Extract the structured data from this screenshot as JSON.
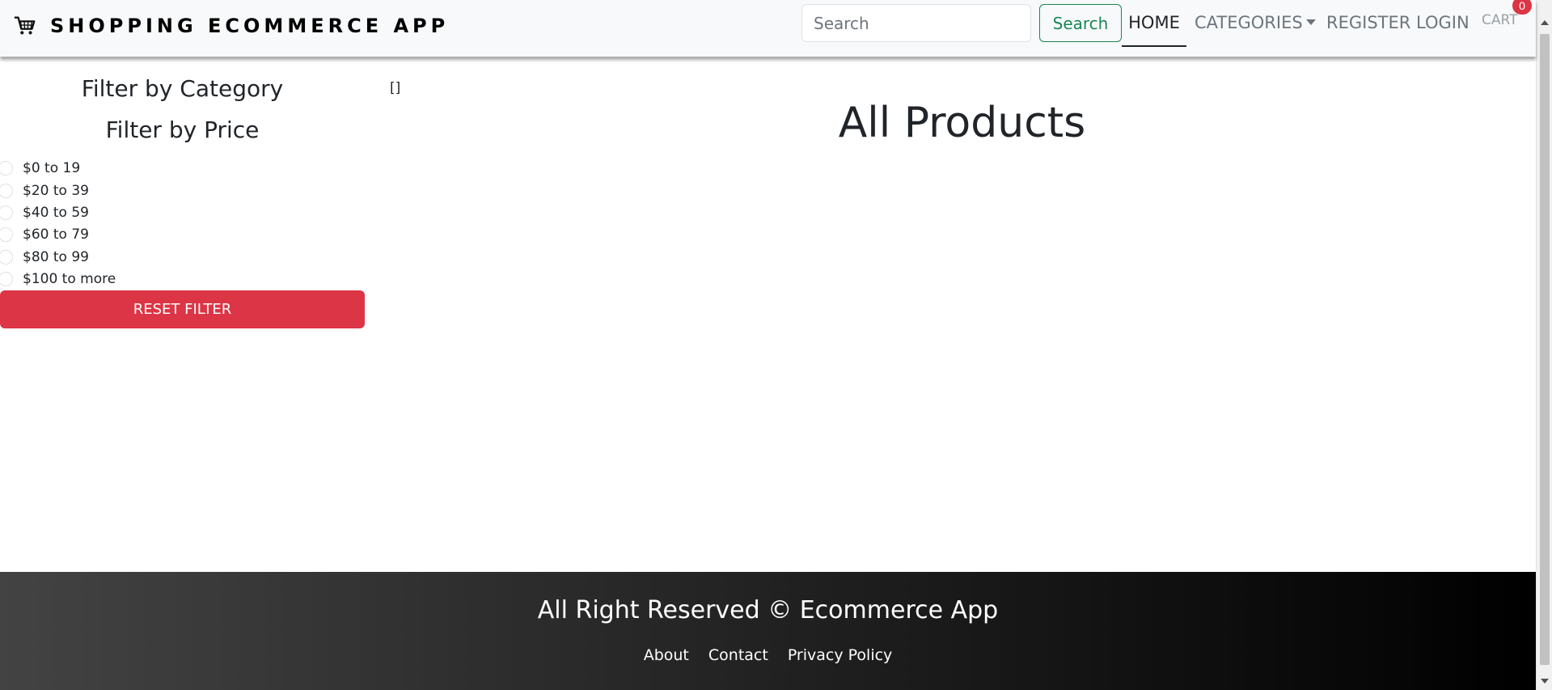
{
  "header": {
    "brand": "SHOPPING ECOMMERCE APP",
    "brand_icon": "shopping-cart-icon",
    "search": {
      "placeholder": "Search",
      "value": "",
      "button_label": "Search"
    },
    "nav": {
      "home": "HOME",
      "categories": "CATEGORIES",
      "register": "REGISTER",
      "login": "LOGIN",
      "cart": "CART",
      "cart_count": "0"
    }
  },
  "sidebar": {
    "category_title": "Filter by Category",
    "price_title": "Filter by Price",
    "price_options": [
      "$0 to 19",
      "$20 to 39",
      "$40 to 59",
      "$60 to 79",
      "$80 to 99",
      "$100 to more"
    ],
    "reset_label": "RESET FILTER",
    "debug_text": "[]"
  },
  "main": {
    "title": "All Products"
  },
  "footer": {
    "title": "All Right Reserved © Ecommerce App",
    "links": [
      "About",
      "Contact",
      "Privacy Policy"
    ]
  },
  "colors": {
    "navbar_bg": "#f8f9fa",
    "search_green": "#198754",
    "danger": "#dc3545",
    "footer_gradient_start": "#434343",
    "footer_gradient_end": "#000000"
  }
}
